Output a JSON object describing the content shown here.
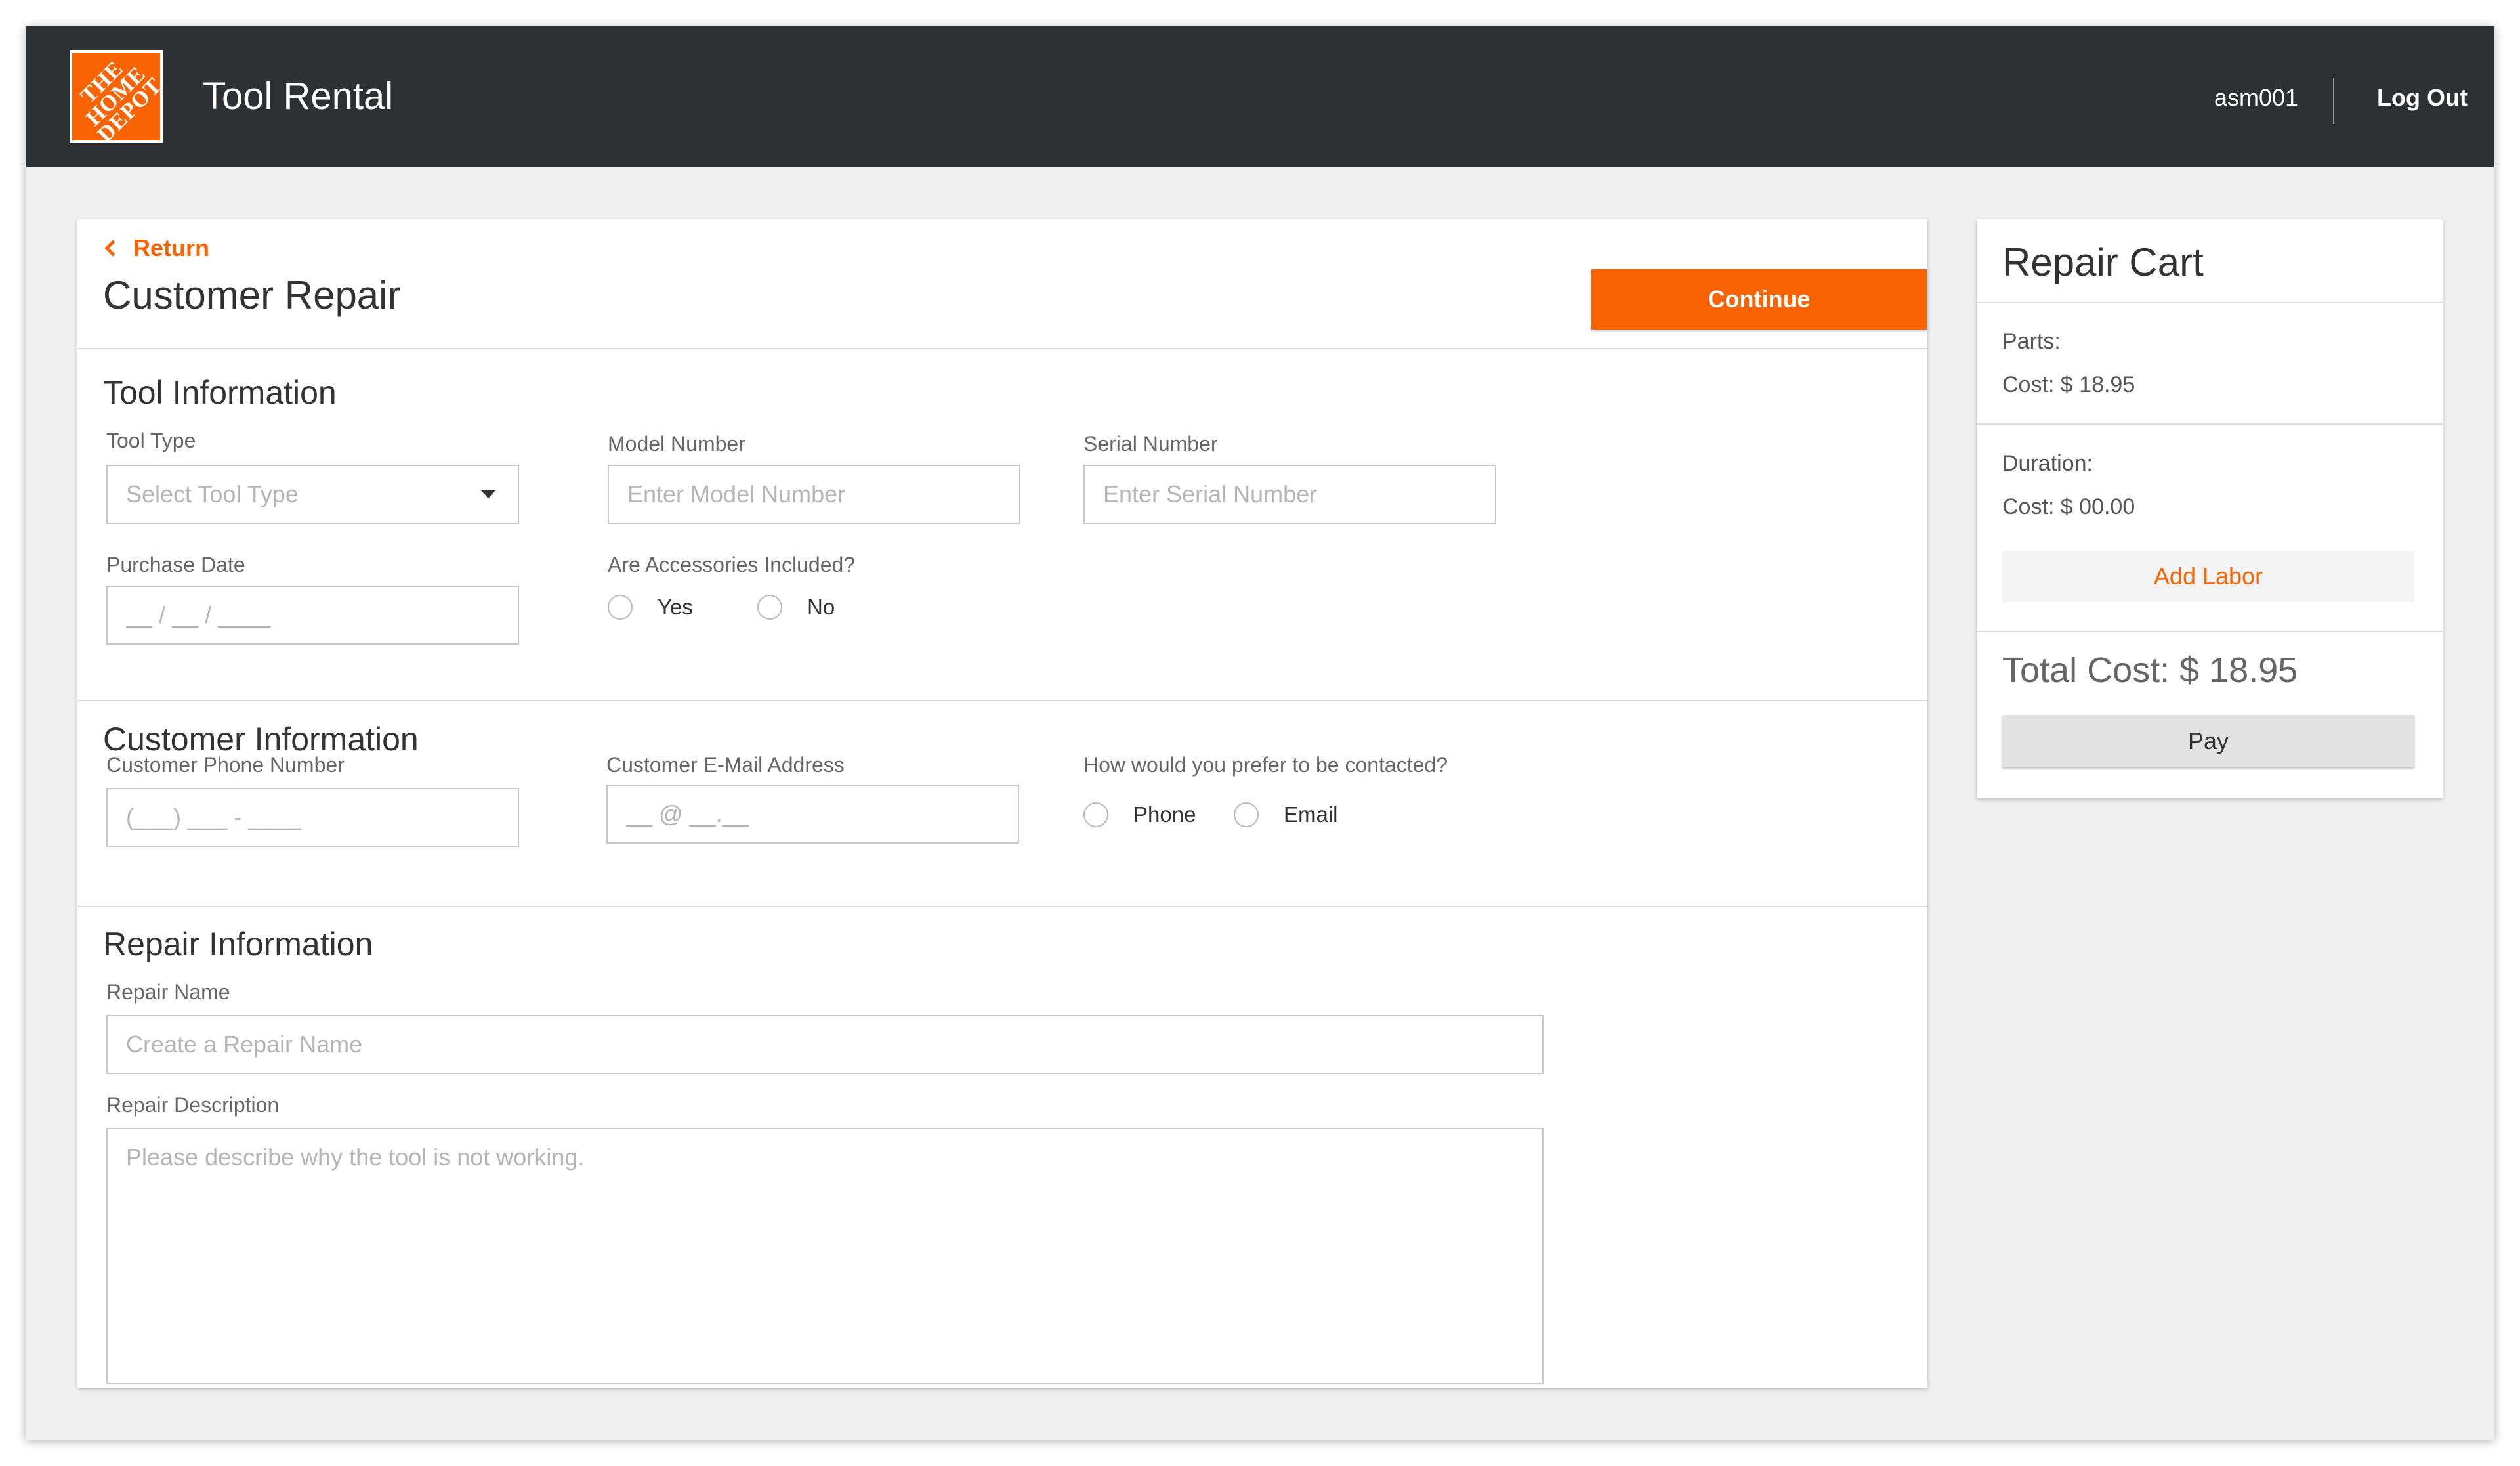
{
  "header": {
    "logo_text": "THE\nHOME\nDEPOT",
    "app_title": "Tool Rental",
    "username": "asm001",
    "logout_label": "Log Out"
  },
  "main": {
    "return_label": "Return",
    "title": "Customer Repair",
    "continue_label": "Continue",
    "tool_info": {
      "title": "Tool Information",
      "tool_type_label": "Tool Type",
      "tool_type_placeholder": "Select Tool Type",
      "model_label": "Model Number",
      "model_placeholder": "Enter Model Number",
      "serial_label": "Serial Number",
      "serial_placeholder": "Enter Serial Number",
      "purchase_label": "Purchase Date",
      "purchase_placeholder": "__ / __ / ____",
      "accessories_label": "Are Accessories Included?",
      "accessories_options": [
        "Yes",
        "No"
      ]
    },
    "customer_info": {
      "title": "Customer Information",
      "phone_label": "Customer Phone Number",
      "phone_placeholder": "(___) ___ - ____",
      "email_label": "Customer E-Mail Address",
      "email_placeholder": "__ @ __.__",
      "contact_label": "How would you prefer to be contacted?",
      "contact_options": [
        "Phone",
        "Email"
      ]
    },
    "repair_info": {
      "title": "Repair Information",
      "name_label": "Repair Name",
      "name_placeholder": "Create a Repair Name",
      "desc_label": "Repair Description",
      "desc_placeholder": "Please describe why the tool is not working."
    }
  },
  "cart": {
    "title": "Repair Cart",
    "parts_label": "Parts:",
    "parts_cost": "Cost: $ 18.95",
    "duration_label": "Duration:",
    "duration_cost": "Cost: $ 00.00",
    "add_labor_label": "Add Labor",
    "total": "Total Cost: $ 18.95",
    "pay_label": "Pay"
  },
  "colors": {
    "brand_orange": "#f96302",
    "header_bg": "#2d3134",
    "page_bg": "#efefef"
  }
}
